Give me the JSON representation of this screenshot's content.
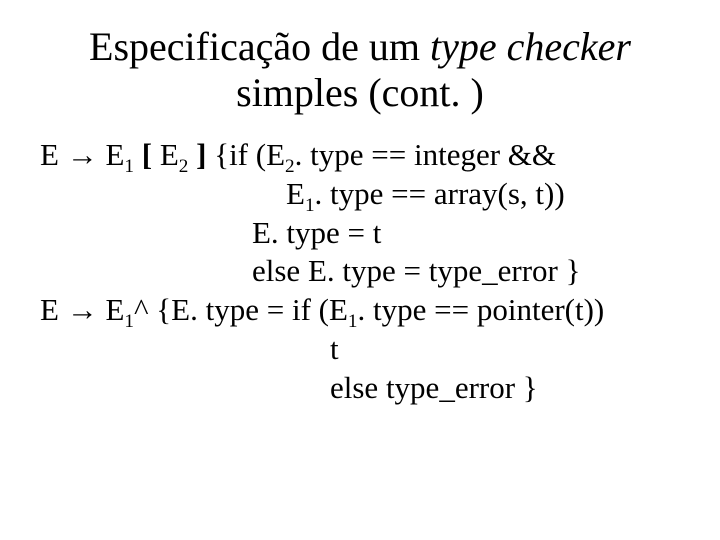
{
  "title": {
    "t1": "Especificação de um ",
    "t2": "type checker",
    "t3": "simples (cont. )"
  },
  "body": {
    "r1a": "E ",
    "r1arrow": "→",
    "r1b": " E",
    "r1s1": "1",
    "r1c": " ",
    "r1lb": "[",
    "r1d": " E",
    "r1s2": "2",
    "r1e": " ",
    "r1rb": "]",
    "r1f": " {if (E",
    "r1s3": "2",
    "r1g": ". type == integer &&",
    "r2a": "E",
    "r2s1": "1",
    "r2b": ". type == array(s, t))",
    "r3": "E. type = t",
    "r4": "else E. type = type_error }",
    "r5a": "E ",
    "r5arrow": "→",
    "r5b": " E",
    "r5s1": "1",
    "r5c": "^ {E. type = if (E",
    "r5s2": "1",
    "r5d": ". type == pointer(t))",
    "r6": "t",
    "r7": "else type_error }"
  }
}
